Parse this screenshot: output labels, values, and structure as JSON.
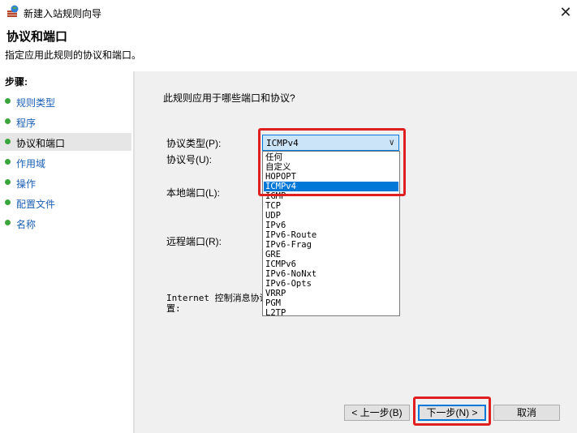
{
  "window": {
    "title": "新建入站规则向导",
    "close_symbol": "✕"
  },
  "header": {
    "heading": "协议和端口",
    "subtitle": "指定应用此规则的协议和端口。"
  },
  "steps": {
    "label": "步骤:",
    "items": [
      {
        "label": "规则类型"
      },
      {
        "label": "程序"
      },
      {
        "label": "协议和端口",
        "active": true
      },
      {
        "label": "作用域"
      },
      {
        "label": "操作"
      },
      {
        "label": "配置文件"
      },
      {
        "label": "名称"
      }
    ]
  },
  "main": {
    "question": "此规则应用于哪些端口和协议?",
    "protocol_type_label": "协议类型(P):",
    "protocol_number_label": "协议号(U):",
    "local_port_label": "本地端口(L):",
    "remote_port_label": "远程端口(R):",
    "icmp_label_line1": "Internet 控制消息协议",
    "icmp_label_line2": "置:",
    "protocol_combo": {
      "selected": "ICMPv4",
      "options": [
        "任何",
        "自定义",
        "HOPOPT",
        "ICMPv4",
        "IGMP",
        "TCP",
        "UDP",
        "IPv6",
        "IPv6-Route",
        "IPv6-Frag",
        "GRE",
        "ICMPv6",
        "IPv6-NoNxt",
        "IPv6-Opts",
        "VRRP",
        "PGM",
        "L2TP"
      ]
    }
  },
  "buttons": {
    "back": "< 上一步(B)",
    "next": "下一步(N) >",
    "cancel": "取消"
  },
  "colors": {
    "highlight": "#e02020",
    "accent": "#0078d7",
    "step_dot": "#3aa53a",
    "link": "#1a5fb4"
  }
}
